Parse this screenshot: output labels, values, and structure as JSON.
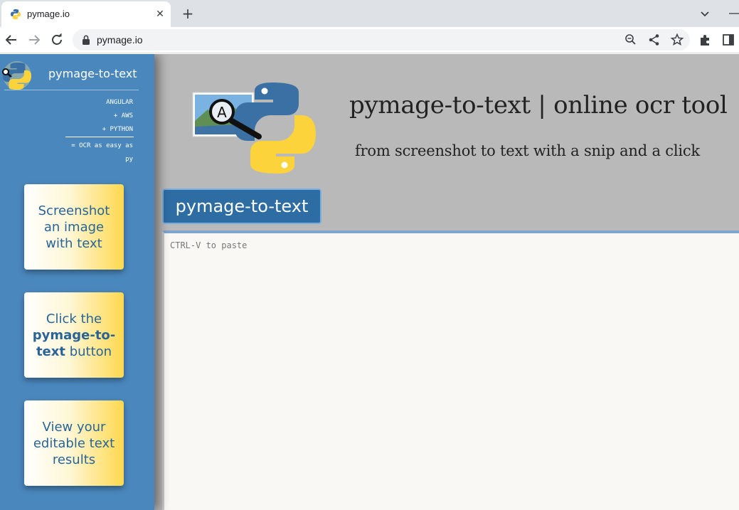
{
  "browser": {
    "tab_title": "pymage.io",
    "tab_close_glyph": "✕",
    "new_tab_glyph": "+",
    "url": "pymage.io",
    "icons": [
      "back-icon",
      "forward-icon",
      "reload-icon",
      "lock-icon",
      "zoom-icon",
      "share-icon",
      "bookmark-star-icon",
      "extensions-icon",
      "side-panel-icon",
      "tab-search-icon",
      "minimize-icon"
    ]
  },
  "sidebar": {
    "title": "pymage-to-text",
    "stack": [
      "ANGULAR",
      "+ AWS",
      "+ PYTHON",
      "= OCR as easy as",
      "py"
    ],
    "steps": [
      {
        "before": "Screenshot an image with text",
        "bold": "",
        "after": ""
      },
      {
        "before": "Click the ",
        "bold": "pymage-to-text",
        "after": " button"
      },
      {
        "before": "View your editable text results",
        "bold": "",
        "after": ""
      }
    ]
  },
  "main": {
    "title": "pymage-to-text | online ocr tool",
    "subtitle": "from screenshot to text with a snip and a click",
    "button_label": "pymage-to-text",
    "paste_placeholder": "CTRL-V to paste"
  },
  "colors": {
    "sidebar": "#4a87bd",
    "page_bg": "#b9b9b9",
    "button": "#2e6da4",
    "card_gradient_end": "#ffd84e",
    "python_blue": "#3a70a4",
    "python_yellow": "#fcd33b"
  }
}
